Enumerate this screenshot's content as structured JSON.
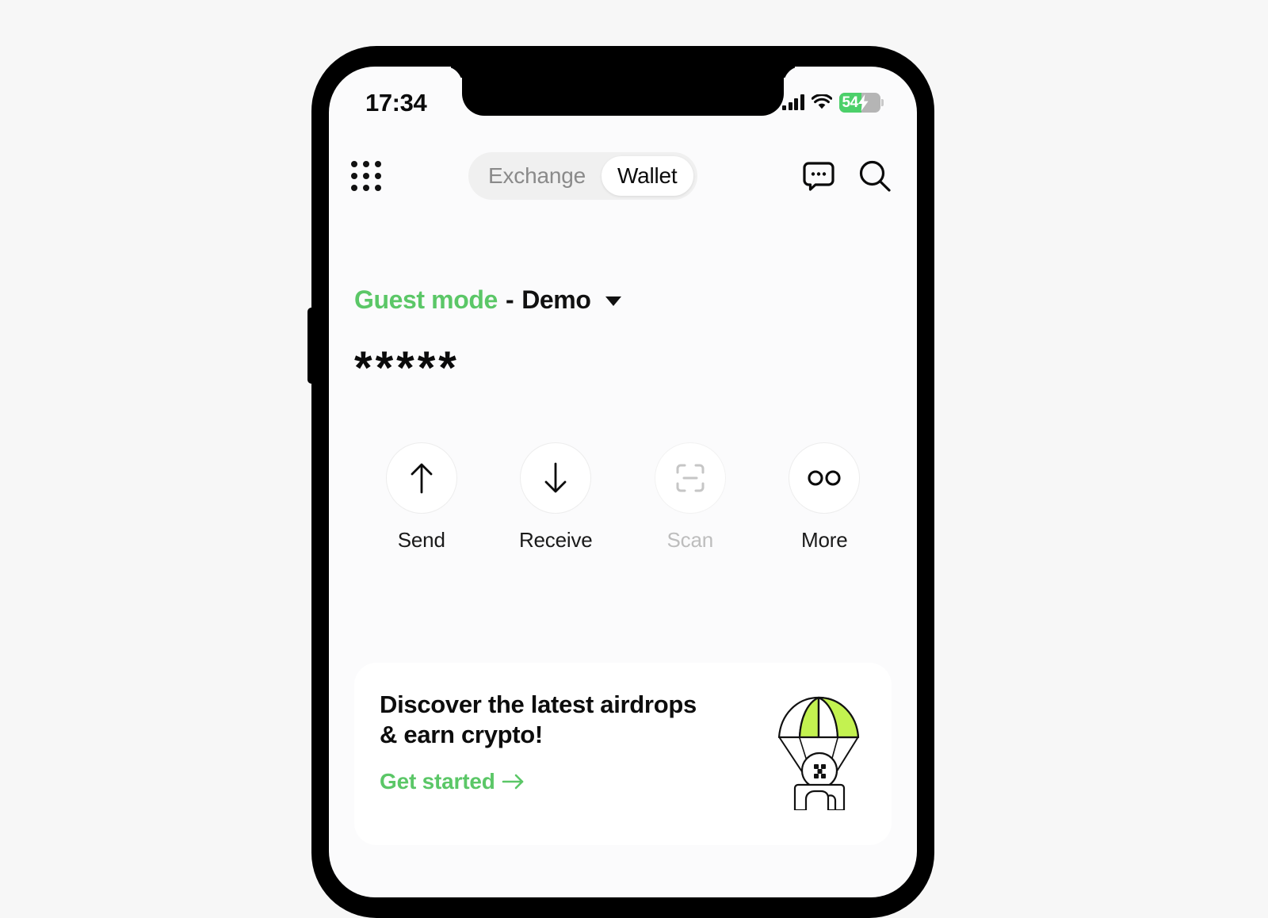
{
  "status_bar": {
    "time": "17:34",
    "signal_icon": "cellular-signal-icon",
    "wifi_icon": "wifi-icon",
    "battery_level": "54",
    "battery_percent": 54,
    "battery_charging": true,
    "battery_icon": "battery-charging-icon"
  },
  "header": {
    "apps_icon": "apps-grid-icon",
    "segments": [
      {
        "label": "Exchange",
        "active": false
      },
      {
        "label": "Wallet",
        "active": true
      }
    ],
    "chat_icon": "chat-bubble-icon",
    "search_icon": "search-icon"
  },
  "account": {
    "mode_label": "Guest mode",
    "mode_separator": " - ",
    "mode_name": "Demo",
    "dropdown_icon": "chevron-down-icon",
    "balance_masked": "*****"
  },
  "actions": [
    {
      "label": "Send",
      "icon": "arrow-up-icon",
      "disabled": false
    },
    {
      "label": "Receive",
      "icon": "arrow-down-icon",
      "disabled": false
    },
    {
      "label": "Scan",
      "icon": "scan-frame-icon",
      "disabled": true
    },
    {
      "label": "More",
      "icon": "infinity-icon",
      "disabled": false
    }
  ],
  "promo": {
    "title": "Discover the latest airdrops & earn crypto!",
    "title_line1": "Discover the latest airdrops",
    "title_line2": "& earn crypto!",
    "link_label": "Get started",
    "link_icon": "arrow-right-icon",
    "illustration": "parachute-airdrop-icon"
  },
  "colors": {
    "accent_green": "#5bc767",
    "illustration_green": "#c3f250",
    "battery_green": "#4cd06a",
    "text_primary": "#0b0b0b",
    "text_muted": "#8a8a8a",
    "text_disabled": "#bdbdbd",
    "page_background": "#f7f7f7",
    "screen_background": "#fbfbfc",
    "card_background": "#ffffff",
    "segment_track": "#f0f0f0"
  }
}
